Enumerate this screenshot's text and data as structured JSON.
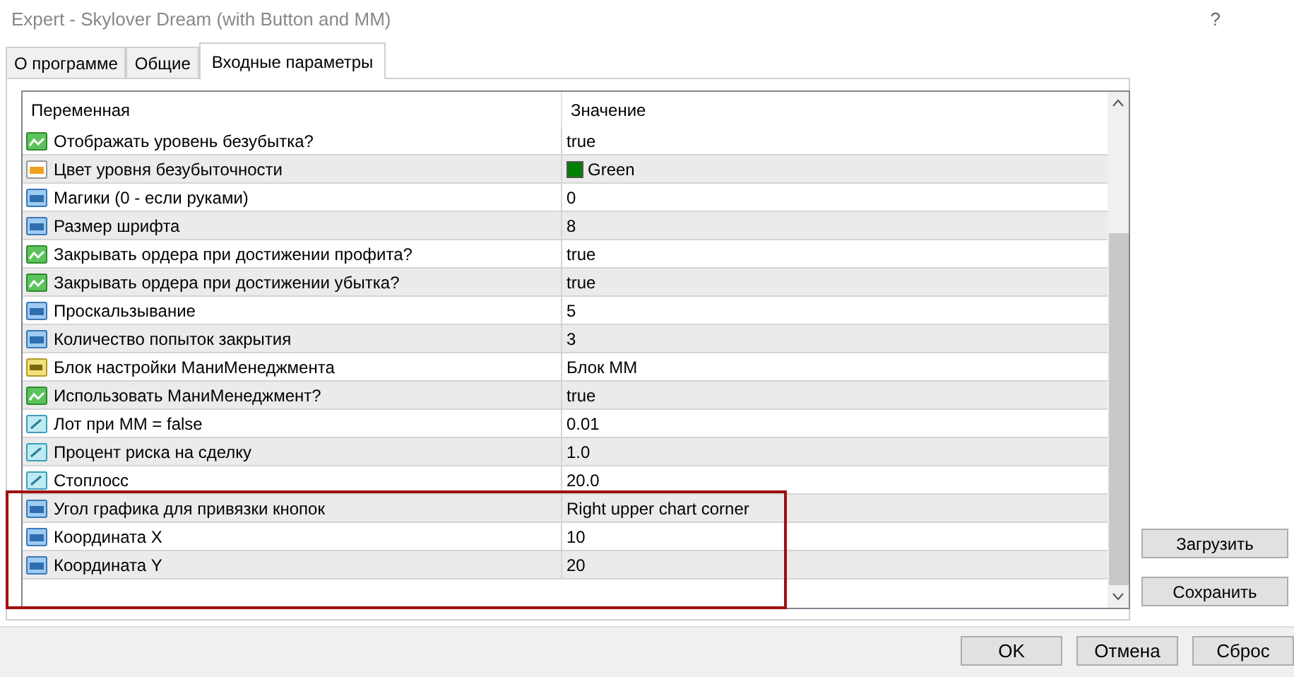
{
  "window": {
    "title": "Expert - Skylover Dream (with Button and MM)",
    "help": "?"
  },
  "tabs": [
    {
      "label": "О программе",
      "selected": false
    },
    {
      "label": "Общие",
      "selected": false
    },
    {
      "label": "Входные параметры",
      "selected": true
    }
  ],
  "table": {
    "columns": [
      "Переменная",
      "Значение"
    ],
    "rows": [
      {
        "kind": "bool",
        "name": "Отображать уровень безубытка?",
        "value": "true"
      },
      {
        "kind": "color",
        "name": "Цвет уровня безубыточности",
        "value": "Green",
        "color": "#008000"
      },
      {
        "kind": "int",
        "name": "Магики (0 - если руками)",
        "value": "0"
      },
      {
        "kind": "int",
        "name": "Размер шрифта",
        "value": "8"
      },
      {
        "kind": "bool",
        "name": "Закрывать ордера при достижении профита?",
        "value": "true"
      },
      {
        "kind": "bool",
        "name": "Закрывать ордера при достижении убытка?",
        "value": "true"
      },
      {
        "kind": "int",
        "name": "Проскальзывание",
        "value": "5"
      },
      {
        "kind": "int",
        "name": "Количество попыток закрытия",
        "value": "3"
      },
      {
        "kind": "string",
        "name": "Блок настройки МаниМенеджмента",
        "value": "Блок MM"
      },
      {
        "kind": "bool",
        "name": "Использовать МаниМенеджмент?",
        "value": "true"
      },
      {
        "kind": "double",
        "name": "Лот при MM = false",
        "value": "0.01"
      },
      {
        "kind": "double",
        "name": "Процент риска на сделку",
        "value": "1.0"
      },
      {
        "kind": "double",
        "name": "Стоплосс",
        "value": "20.0"
      },
      {
        "kind": "int",
        "name": "Угол графика для привязки кнопок",
        "value": "Right upper chart corner"
      },
      {
        "kind": "int",
        "name": "Координата X",
        "value": "10"
      },
      {
        "kind": "int",
        "name": "Координата Y",
        "value": "20"
      }
    ]
  },
  "side_buttons": [
    "Загрузить",
    "Сохранить"
  ],
  "buttons": [
    "OK",
    "Отмена",
    "Сброс"
  ]
}
